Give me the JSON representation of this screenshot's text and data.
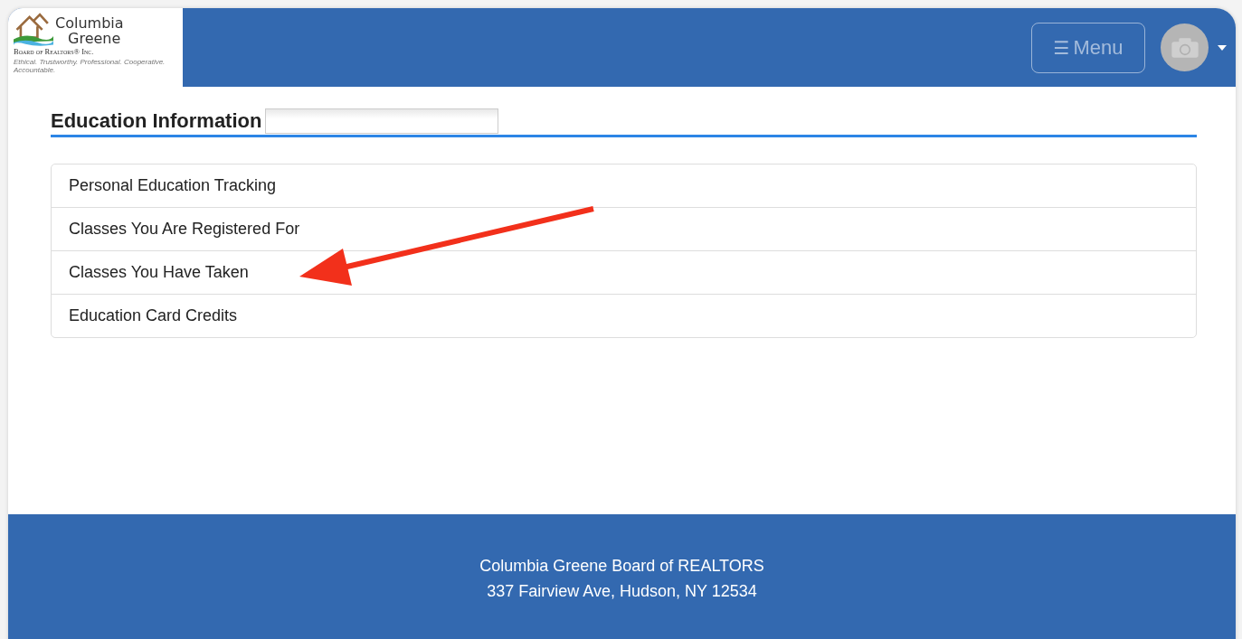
{
  "header": {
    "logo": {
      "line_1": "Columbia",
      "line_2": "Greene",
      "line_3": "Board of Realtors® Inc.",
      "tagline": "Ethical. Trustworthy. Professional. Cooperative. Accountable."
    },
    "menu_button": {
      "icon": "☰",
      "label": "Menu"
    }
  },
  "section": {
    "title": "Education Information"
  },
  "links": [
    {
      "label": "Personal Education Tracking"
    },
    {
      "label": "Classes You Are Registered For"
    },
    {
      "label": "Classes You Have Taken"
    },
    {
      "label": "Education Card Credits"
    }
  ],
  "footer": {
    "lines": [
      "Columbia Greene Board of REALTORS",
      "337 Fairview Ave, Hudson, NY 12534"
    ]
  }
}
